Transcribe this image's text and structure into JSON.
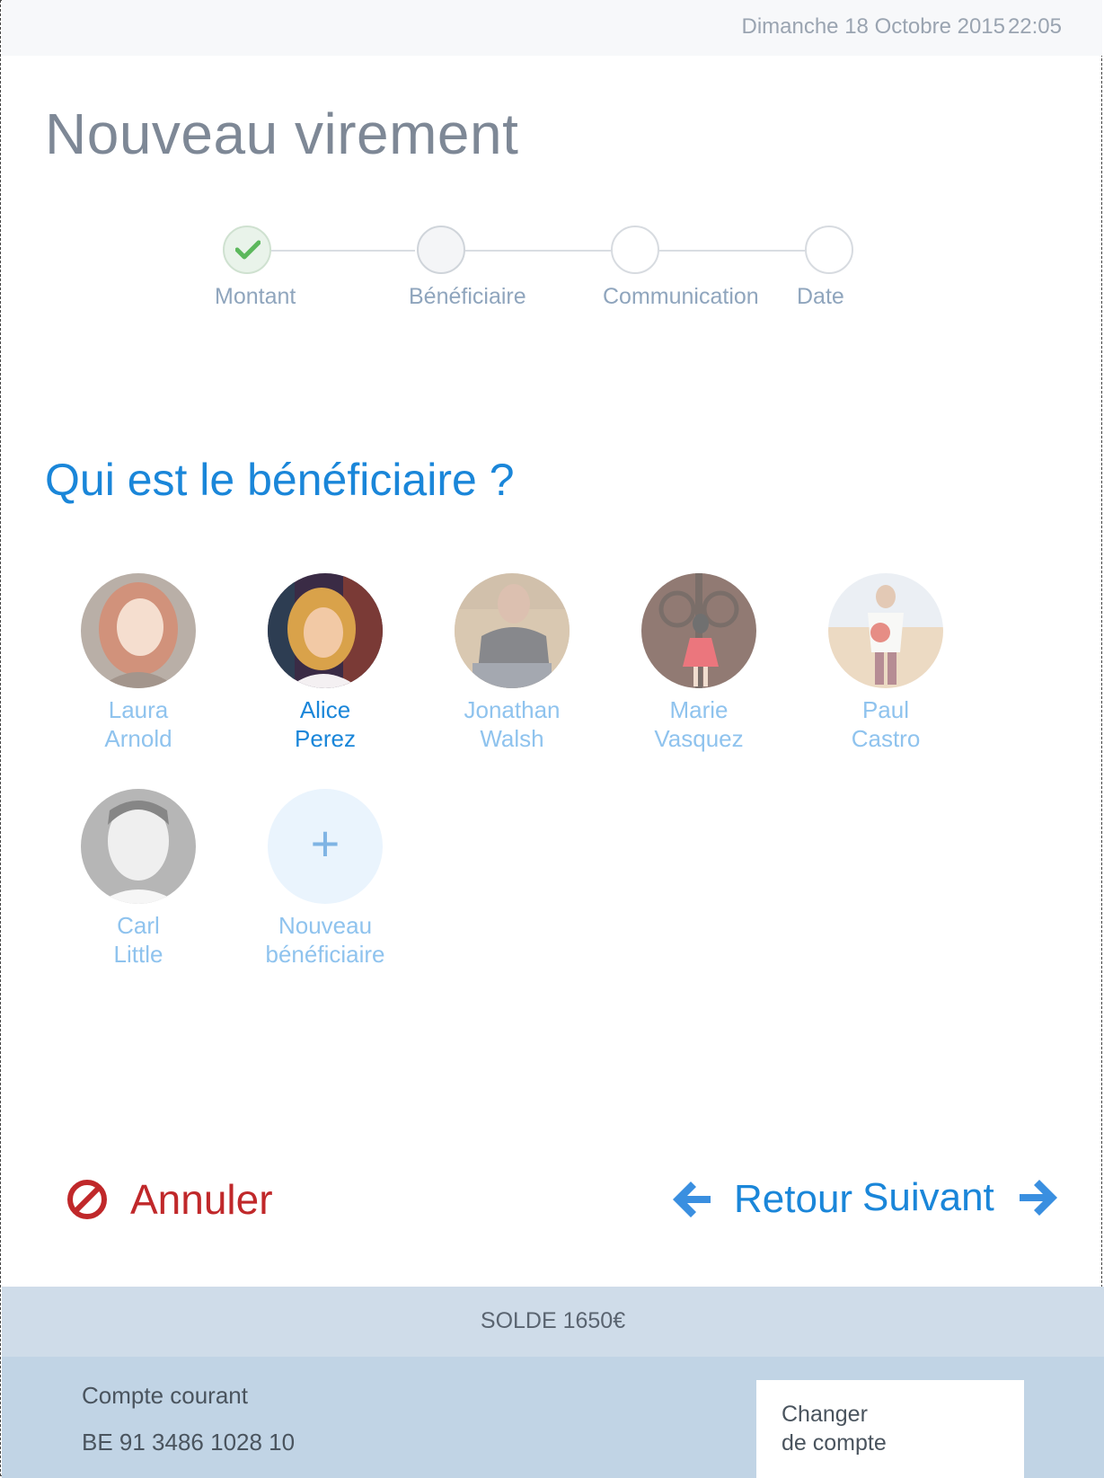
{
  "status_bar": {
    "date": "Dimanche 18 Octobre 2015",
    "time": "22:05"
  },
  "page_title": "Nouveau virement",
  "steps": [
    {
      "label": "Montant",
      "state": "done"
    },
    {
      "label": "Bénéficiaire",
      "state": "current"
    },
    {
      "label": "Communication",
      "state": "todo"
    },
    {
      "label": "Date",
      "state": "todo"
    }
  ],
  "question": "Qui est le bénéficiaire ?",
  "beneficiaries": [
    {
      "first": "Laura",
      "last": "Arnold",
      "selected": false
    },
    {
      "first": "Alice",
      "last": "Perez",
      "selected": true
    },
    {
      "first": "Jonathan",
      "last": "Walsh",
      "selected": false
    },
    {
      "first": "Marie",
      "last": "Vasquez",
      "selected": false
    },
    {
      "first": "Paul",
      "last": "Castro",
      "selected": false
    },
    {
      "first": "Carl",
      "last": "Little",
      "selected": false
    }
  ],
  "new_beneficiary": {
    "icon": "+",
    "line1": "Nouveau",
    "line2": "bénéficiaire"
  },
  "actions": {
    "cancel": "Annuler",
    "back": "Retour",
    "next": "Suivant"
  },
  "footer": {
    "balance": "SOLDE 1650€",
    "account_name": "Compte courant",
    "account_iban": "BE 91 3486 1028 10",
    "change_line1": "Changer",
    "change_line2": "de compte"
  },
  "colors": {
    "accent": "#1a86d9",
    "cancel": "#c0282a",
    "done_check": "#5cb85c"
  }
}
